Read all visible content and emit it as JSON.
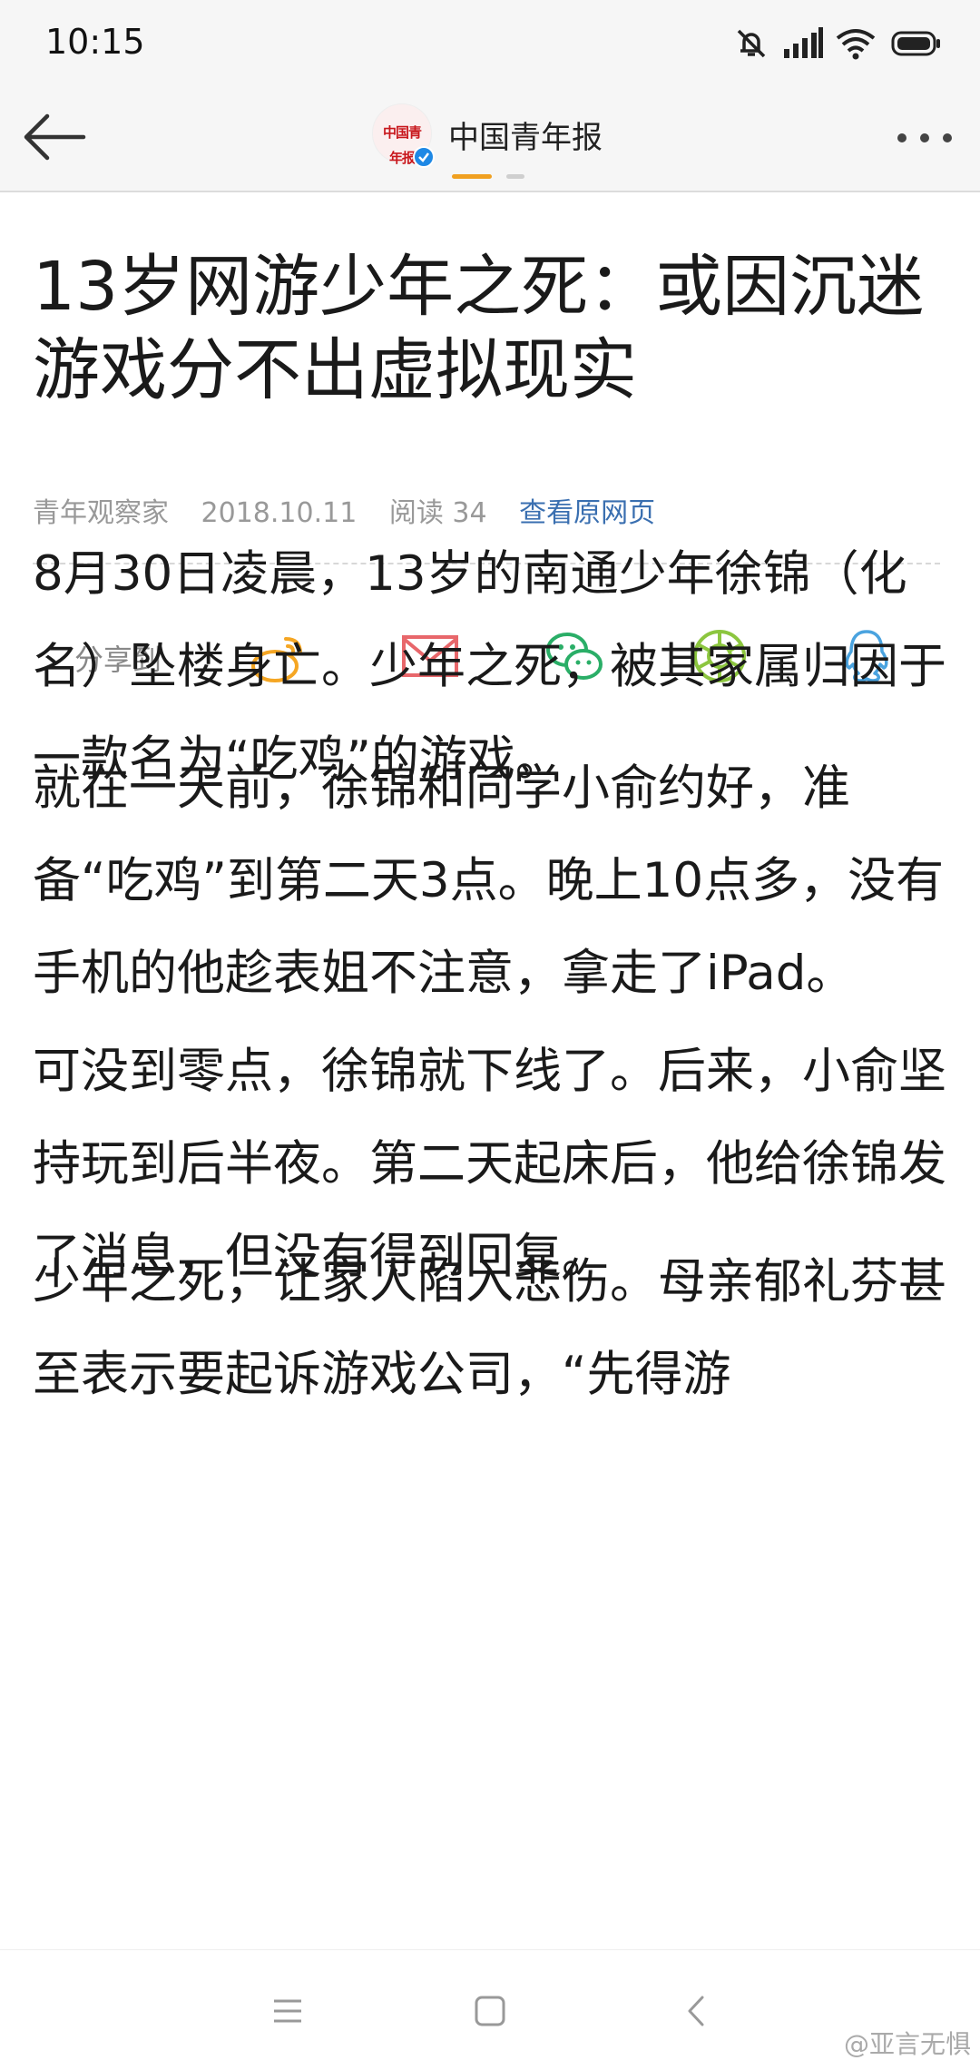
{
  "status_bar": {
    "time": "10:15",
    "icons": [
      "mute-icon",
      "signal-icon",
      "wifi-icon",
      "battery-icon"
    ]
  },
  "header": {
    "back_icon": "back-arrow-icon",
    "channel_name": "中国青年报",
    "channel_logo_text": "中国青年报",
    "more_icon": "more-dots-icon",
    "colors": {
      "active_dot": "#f0a020",
      "inactive_dot": "#cfcfcf"
    }
  },
  "article": {
    "title": "13岁网游少年之死：或因沉迷游戏分不出虚拟现实",
    "meta": {
      "author": "青年观察家",
      "date": "2018.10.11",
      "reads": "阅读 34",
      "source_link": "查看原网页"
    },
    "share": {
      "label": "分享到",
      "targets": [
        {
          "icon": "weibo-icon",
          "color": "#f5a623"
        },
        {
          "icon": "mail-icon",
          "color": "#e8676b"
        },
        {
          "icon": "wechat-icon",
          "color": "#2aae67"
        },
        {
          "icon": "moments-icon",
          "color": "#8cc63f"
        },
        {
          "icon": "qq-icon",
          "color": "#4aa3df"
        }
      ]
    },
    "paragraphs": [
      "8月30日凌晨，13岁的南通少年徐锦（化名）坠楼身亡。少年之死，被其家属归因于一款名为“吃鸡”的游戏。",
      "就在一天前，徐锦和同学小俞约好，准备“吃鸡”到第二天3点。晚上10点多，没有手机的他趁表姐不注意，拿走了iPad。",
      "可没到零点，徐锦就下线了。后来，小俞坚持玩到后半夜。第二天起床后，他给徐锦发了消息，但没有得到回复。",
      "少年之死，让家人陷入悲伤。母亲郁礼芬甚至表示要起诉游戏公司，“先得游"
    ]
  },
  "navbar": {
    "buttons": [
      "menu-icon",
      "home-icon",
      "back-icon"
    ],
    "watermark": "@亚言无惧"
  }
}
